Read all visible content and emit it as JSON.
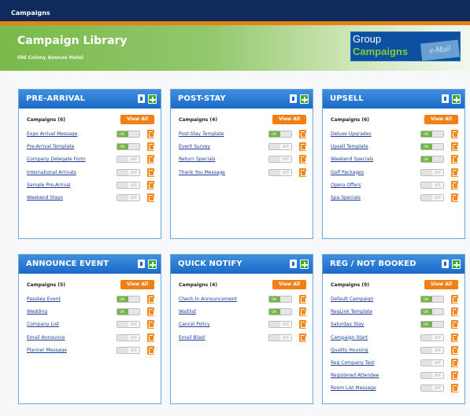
{
  "window": {
    "title": "Campaigns"
  },
  "header": {
    "title": "Campaign Library",
    "subtitle": "Old Colony Avenue Hotel"
  },
  "logo": {
    "line1": "Group",
    "line2": "Campaigns",
    "stamp": "e-Mail"
  },
  "labels": {
    "view_all": "View All",
    "on": "ON",
    "off": "OFF"
  },
  "colors": {
    "topbar": "#0f2a5c",
    "accent": "#e8810f",
    "panel_header": "#1a6ac9",
    "on": "#72b545",
    "trash": "#f08a1d"
  },
  "panels": [
    {
      "title": "PRE-ARRIVAL",
      "count_label": "Campaigns (6)",
      "items": [
        {
          "name": "Expo Arrival Message",
          "on": true
        },
        {
          "name": "Pre-Arrival Template",
          "on": true
        },
        {
          "name": "Company Delegate Form",
          "on": false
        },
        {
          "name": "International Arrivals",
          "on": false
        },
        {
          "name": "Sample Pre-Arrival",
          "on": false
        },
        {
          "name": "Weekend Stays",
          "on": false
        }
      ]
    },
    {
      "title": "POST-STAY",
      "count_label": "Campaigns (4)",
      "items": [
        {
          "name": "Post-Stay Template",
          "on": true
        },
        {
          "name": "Event Survey",
          "on": false
        },
        {
          "name": "Return Specials",
          "on": false
        },
        {
          "name": "Thank You Message",
          "on": false
        }
      ]
    },
    {
      "title": "UPSELL",
      "count_label": "Campaigns (6)",
      "items": [
        {
          "name": "Deluxe Upgrades",
          "on": true
        },
        {
          "name": "Upsell Template",
          "on": true
        },
        {
          "name": "Weekend Specials",
          "on": true
        },
        {
          "name": "Golf Packages",
          "on": false
        },
        {
          "name": "Opera Offers",
          "on": false
        },
        {
          "name": "Spa Specials",
          "on": false
        }
      ]
    },
    {
      "title": "ANNOUNCE EVENT",
      "count_label": "Campaigns (5)",
      "items": [
        {
          "name": "Passkey Event",
          "on": true
        },
        {
          "name": "Wedding",
          "on": true
        },
        {
          "name": "Company List",
          "on": false
        },
        {
          "name": "Email Announce",
          "on": false
        },
        {
          "name": "Planner Message",
          "on": false
        }
      ]
    },
    {
      "title": "QUICK NOTIFY",
      "count_label": "Campaigns (4)",
      "items": [
        {
          "name": "Check-In Announcement",
          "on": true
        },
        {
          "name": "Waitlist",
          "on": true
        },
        {
          "name": "Cancel Policy",
          "on": false
        },
        {
          "name": "Email Blast",
          "on": false
        }
      ]
    },
    {
      "title": "REG / NOT BOOKED",
      "count_label": "Campaigns (9)",
      "items": [
        {
          "name": "Default Campaign",
          "on": true
        },
        {
          "name": "RegLink Template",
          "on": true
        },
        {
          "name": "Saturday Stay",
          "on": true
        },
        {
          "name": "Campaign Start",
          "on": false
        },
        {
          "name": "Quality Housing",
          "on": false
        },
        {
          "name": "Reg Company Test",
          "on": false
        },
        {
          "name": "Registered Attendee",
          "on": false
        },
        {
          "name": "Room List Message",
          "on": false
        }
      ]
    }
  ]
}
